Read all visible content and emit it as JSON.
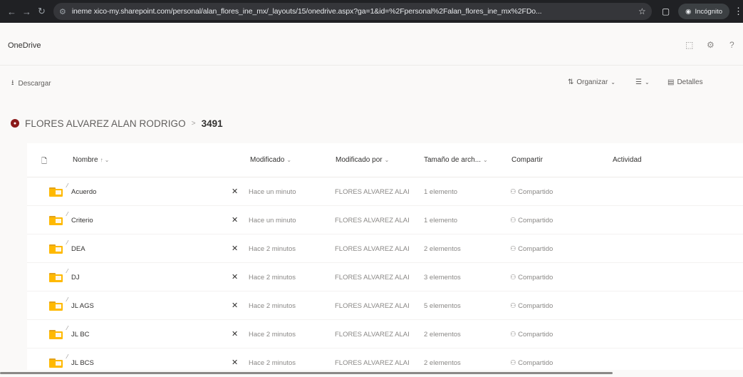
{
  "browser": {
    "url": "ineme xico-my.sharepoint.com/personal/alan_flores_ine_mx/_layouts/15/onedrive.aspx?ga=1&id=%2Fpersonal%2Falan_flores_ine_mx%2FDo...",
    "incognito_label": "Incógnito"
  },
  "header": {
    "app_title": "OneDrive"
  },
  "command_bar": {
    "download_label": "Descargar",
    "organize_label": "Organizar",
    "details_label": "Detalles"
  },
  "breadcrumb": {
    "owner": "FLORES ALVAREZ ALAN RODRIGO",
    "separator": ">",
    "current": "3491"
  },
  "list": {
    "columns": {
      "name": "Nombre",
      "modified": "Modificado",
      "modified_by": "Modificado por",
      "size": "Tamaño de arch...",
      "share": "Compartir",
      "activity": "Actividad"
    },
    "rows": [
      {
        "name": "Acuerdo",
        "modified": "Hace un minuto",
        "modified_by": "FLORES ALVAREZ ALAI",
        "size": "1 elemento",
        "sharing": "Compartido"
      },
      {
        "name": "Criterio",
        "modified": "Hace un minuto",
        "modified_by": "FLORES ALVAREZ ALAI",
        "size": "1 elemento",
        "sharing": "Compartido"
      },
      {
        "name": "DEA",
        "modified": "Hace 2 minutos",
        "modified_by": "FLORES ALVAREZ ALAI",
        "size": "2 elementos",
        "sharing": "Compartido"
      },
      {
        "name": "DJ",
        "modified": "Hace 2 minutos",
        "modified_by": "FLORES ALVAREZ ALAI",
        "size": "3 elementos",
        "sharing": "Compartido"
      },
      {
        "name": "JL AGS",
        "modified": "Hace 2 minutos",
        "modified_by": "FLORES ALVAREZ ALAI",
        "size": "5 elementos",
        "sharing": "Compartido"
      },
      {
        "name": "JL BC",
        "modified": "Hace 2 minutos",
        "modified_by": "FLORES ALVAREZ ALAI",
        "size": "2 elementos",
        "sharing": "Compartido"
      },
      {
        "name": "JL BCS",
        "modified": "Hace 2 minutos",
        "modified_by": "FLORES ALVAREZ ALAI",
        "size": "2 elementos",
        "sharing": "Compartido"
      }
    ]
  },
  "colors": {
    "owner_avatar": "#8b1a1a",
    "folder": "#ffb900"
  }
}
